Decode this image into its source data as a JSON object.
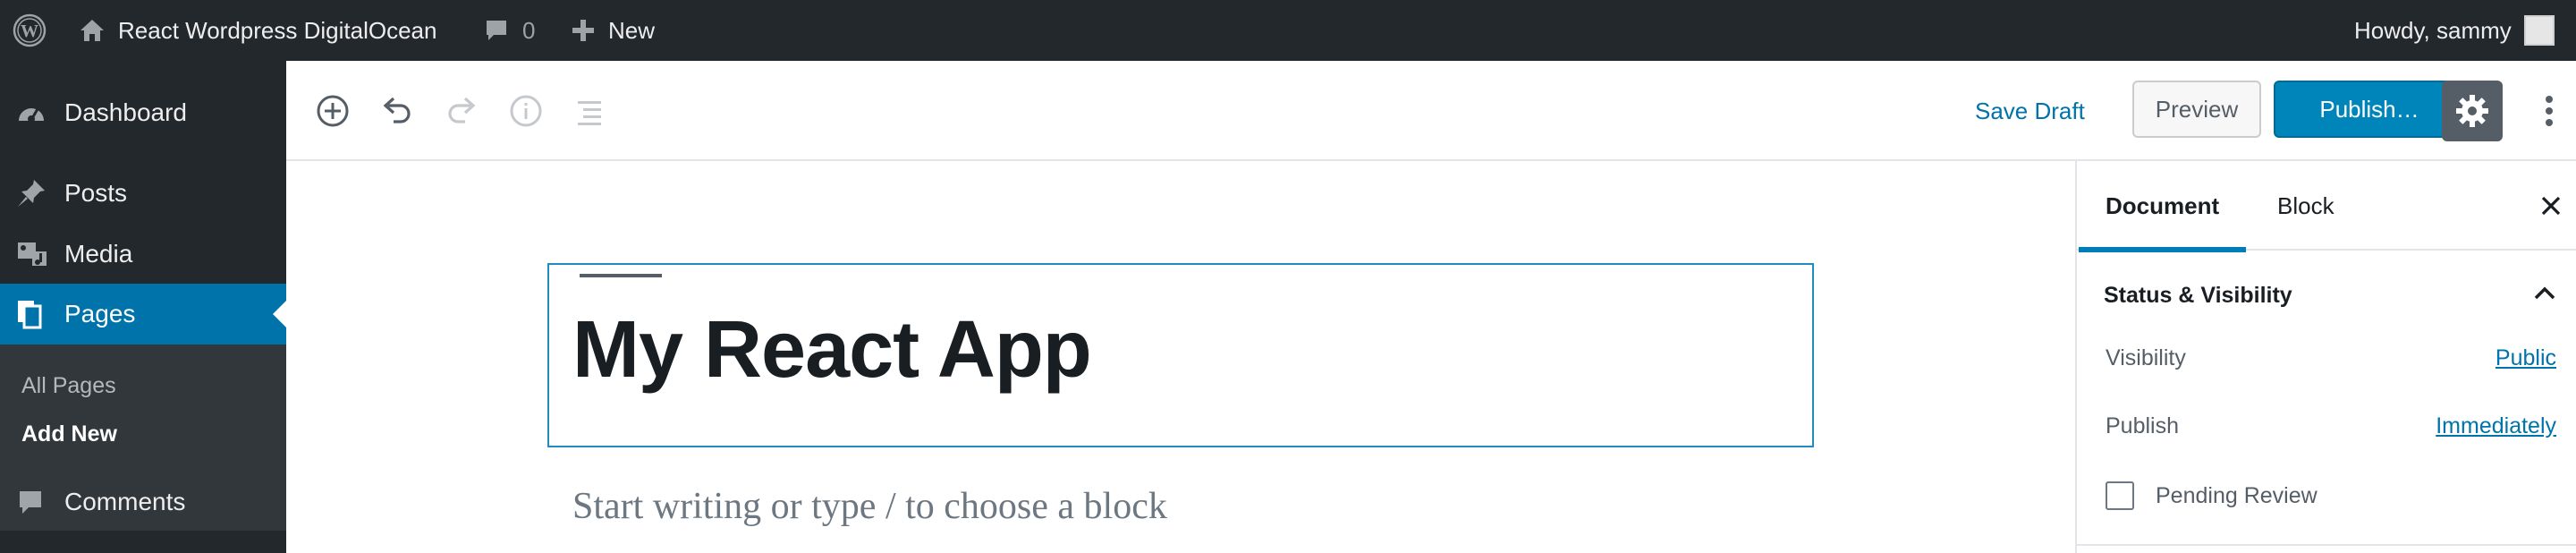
{
  "admin_bar": {
    "site_name": "React Wordpress DigitalOcean",
    "comments_count": "0",
    "new_label": "New",
    "greeting": "Howdy, sammy"
  },
  "admin_menu": {
    "items": [
      {
        "label": "Dashboard",
        "icon": "dashboard-icon"
      },
      {
        "label": "Posts",
        "icon": "pin-icon"
      },
      {
        "label": "Media",
        "icon": "media-icon"
      },
      {
        "label": "Pages",
        "icon": "pages-icon",
        "current": true
      },
      {
        "label": "Comments",
        "icon": "comment-icon"
      }
    ],
    "pages_submenu": [
      "All Pages",
      "Add New"
    ]
  },
  "editor_toolbar": {
    "save_draft_label": "Save Draft",
    "preview_label": "Preview",
    "publish_label": "Publish…"
  },
  "editor": {
    "title": "My React App",
    "placeholder": "Start writing or type / to choose a block"
  },
  "sidebar": {
    "tabs": [
      "Document",
      "Block"
    ],
    "active_tab": "Document",
    "panel_title": "Status & Visibility",
    "visibility_label": "Visibility",
    "visibility_value": "Public",
    "publish_label": "Publish",
    "publish_value": "Immediately",
    "pending_review_label": "Pending Review",
    "pending_review_checked": false
  },
  "colors": {
    "admin_dark": "#23282d",
    "accent_blue": "#0073aa",
    "publish_blue": "#0085ba",
    "block_border": "#1e8cbe"
  }
}
